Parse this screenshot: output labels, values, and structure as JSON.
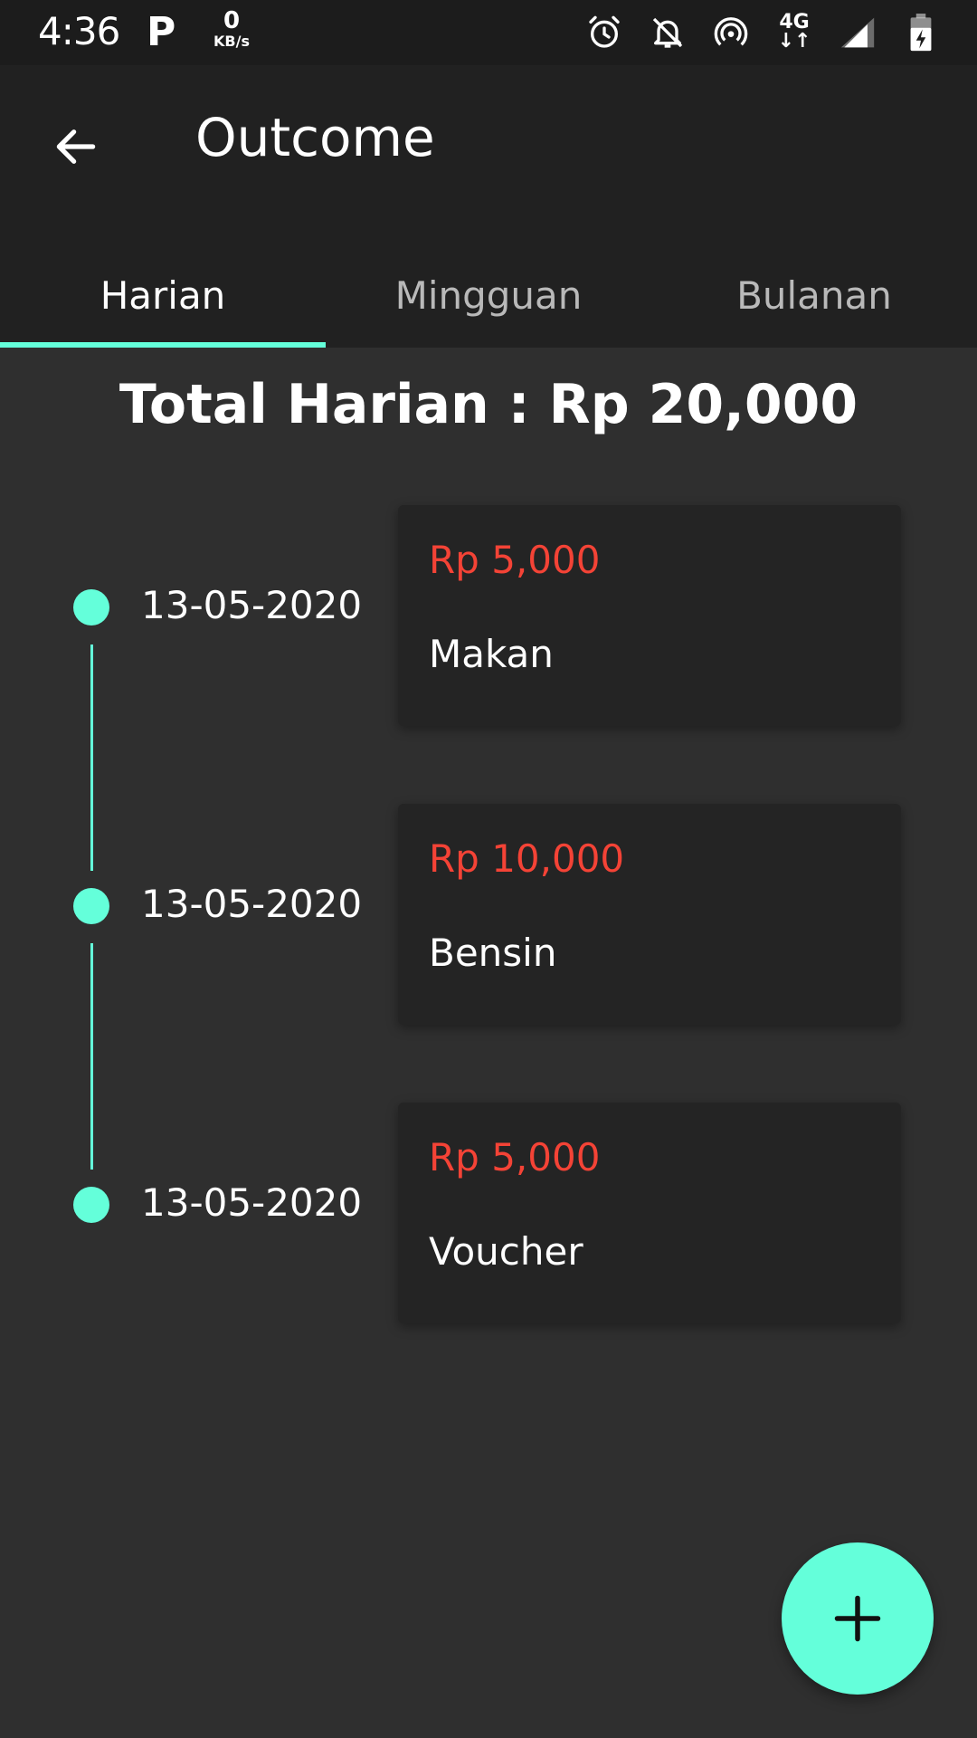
{
  "status_bar": {
    "time": "4:36",
    "p_icon": "P",
    "speed_value": "0",
    "speed_unit": "KB/s",
    "network_label": "4G",
    "icons": [
      "alarm-icon",
      "notifications-off-icon",
      "hotspot-icon",
      "network-4g-icon",
      "signal-icon",
      "battery-charging-icon"
    ]
  },
  "app_bar": {
    "back_icon": "arrow-back-icon",
    "title": "Outcome"
  },
  "tabs": [
    {
      "label": "Harian",
      "active": true
    },
    {
      "label": "Mingguan",
      "active": false
    },
    {
      "label": "Bulanan",
      "active": false
    }
  ],
  "summary": {
    "total_text": "Total Harian : Rp 20,000"
  },
  "entries": [
    {
      "date": "13-05-2020",
      "amount": "Rp 5,000",
      "category": "Makan"
    },
    {
      "date": "13-05-2020",
      "amount": "Rp 10,000",
      "category": "Bensin"
    },
    {
      "date": "13-05-2020",
      "amount": "Rp 5,000",
      "category": "Voucher"
    }
  ],
  "fab": {
    "icon": "plus-icon"
  },
  "colors": {
    "accent": "#64ffda",
    "amount": "#f44336",
    "background": "#2f2f2f",
    "app_bar": "#212121",
    "card": "#242424"
  }
}
